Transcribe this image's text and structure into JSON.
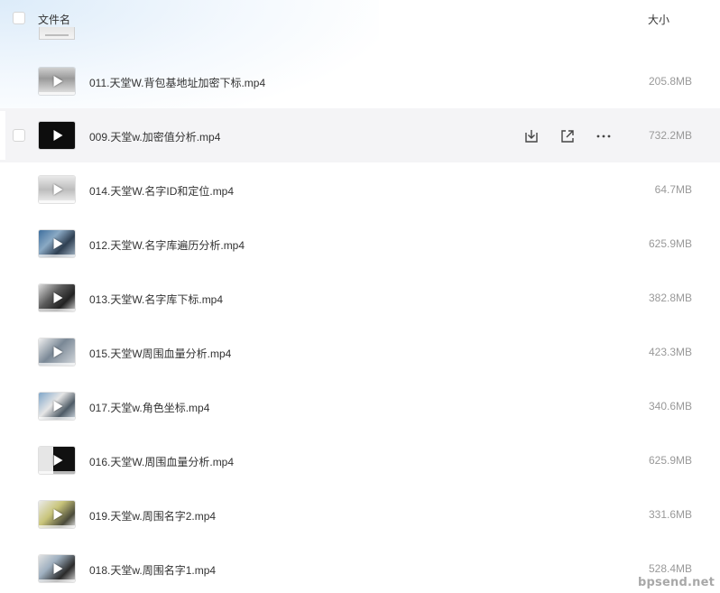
{
  "header": {
    "name_label": "文件名",
    "size_label": "大小"
  },
  "files": [
    {
      "name": "011.天堂W.背包基地址加密下标.mp4",
      "size": "205.8MB",
      "thumb": "gray"
    },
    {
      "name": "009.天堂w.加密值分析.mp4",
      "size": "732.2MB",
      "thumb": "black",
      "hovered": true
    },
    {
      "name": "014.天堂W.名字ID和定位.mp4",
      "size": "64.7MB",
      "thumb": "light"
    },
    {
      "name": "012.天堂W.名字库遍历分析.mp4",
      "size": "625.9MB",
      "thumb": "blue"
    },
    {
      "name": "013.天堂W.名字库下标.mp4",
      "size": "382.8MB",
      "thumb": "dark"
    },
    {
      "name": "015.天堂W周围血量分析.mp4",
      "size": "423.3MB",
      "thumb": "mixed"
    },
    {
      "name": "017.天堂w.角色坐标.mp4",
      "size": "340.6MB",
      "thumb": "desk"
    },
    {
      "name": "016.天堂W.周围血量分析.mp4",
      "size": "625.9MB",
      "thumb": "black-left"
    },
    {
      "name": "019.天堂w.周围名字2.mp4",
      "size": "331.6MB",
      "thumb": "bright"
    },
    {
      "name": "018.天堂w.周围名字1.mp4",
      "size": "528.4MB",
      "thumb": "photo"
    }
  ],
  "row_actions": {
    "icons": [
      "download-icon",
      "share-icon",
      "more-icon"
    ]
  },
  "watermark": "bpsend.net",
  "colors": {
    "text": "#333333",
    "size_text": "#999999",
    "hover_row": "#f4f4f6"
  }
}
